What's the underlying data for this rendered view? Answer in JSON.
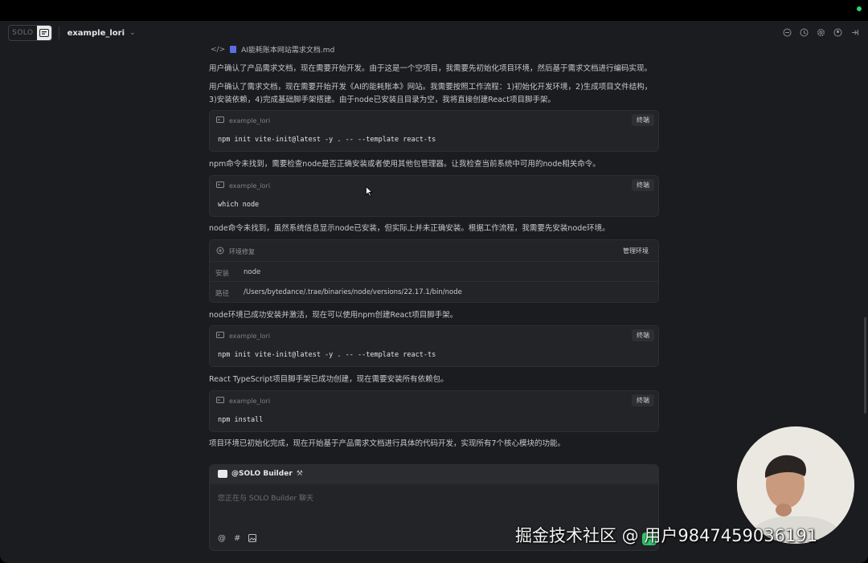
{
  "app": {
    "logo_text": "SOLO",
    "project_name": "example_lori"
  },
  "file_chip": {
    "name": "AI能耗账本网站需求文档.md"
  },
  "messages": [
    "用户确认了产品需求文档，现在需要开始开发。由于这是一个空项目，我需要先初始化项目环境，然后基于需求文档进行编码实现。",
    "用户确认了需求文档，现在需要开始开发《AI的能耗账本》网站。我需要按照工作流程：1)初始化开发环境，2)生成项目文件结构，3)安装依赖，4)完成基础脚手架搭建。由于node已安装且目录为空，我将直接创建React项目脚手架。",
    "npm命令未找到，需要检查node是否正确安装或者使用其他包管理器。让我检查当前系统中可用的node相关命令。",
    "node命令未找到，虽然系统信息显示node已安装，但实际上并未正确安装。根据工作流程，我需要先安装node环境。",
    "node环境已成功安装并激活，现在可以使用npm创建React项目脚手架。",
    "React TypeScript项目脚手架已成功创建，现在需要安装所有依赖包。",
    "项目环境已初始化完成，现在开始基于产品需求文档进行具体的代码开发，实现所有7个核心模块的功能。"
  ],
  "terminals": [
    {
      "project": "example_lori",
      "button": "终端",
      "command": "npm init vite-init@latest -y . -- --template react-ts"
    },
    {
      "project": "example_lori",
      "button": "终端",
      "command": "which node"
    },
    {
      "project": "example_lori",
      "button": "终端",
      "command": "npm init vite-init@latest -y . -- --template react-ts"
    },
    {
      "project": "example_lori",
      "button": "终端",
      "command": "npm install"
    }
  ],
  "env_card": {
    "title": "环境修复",
    "button": "管理环境",
    "rows": [
      {
        "key": "安装",
        "value": "node"
      },
      {
        "key": "路径",
        "value": "/Users/bytedance/.trae/binaries/node/versions/22.17.1/bin/node"
      }
    ]
  },
  "chat": {
    "agent": "@SOLO Builder",
    "placeholder": "您正在与 SOLO Builder 聊天",
    "tools": [
      "@",
      "#"
    ]
  },
  "watermark": "掘金技术社区 @ 用户9847459036191",
  "colors": {
    "accent": "#31c46b",
    "background": "#1b1c1f",
    "card": "#222427"
  }
}
